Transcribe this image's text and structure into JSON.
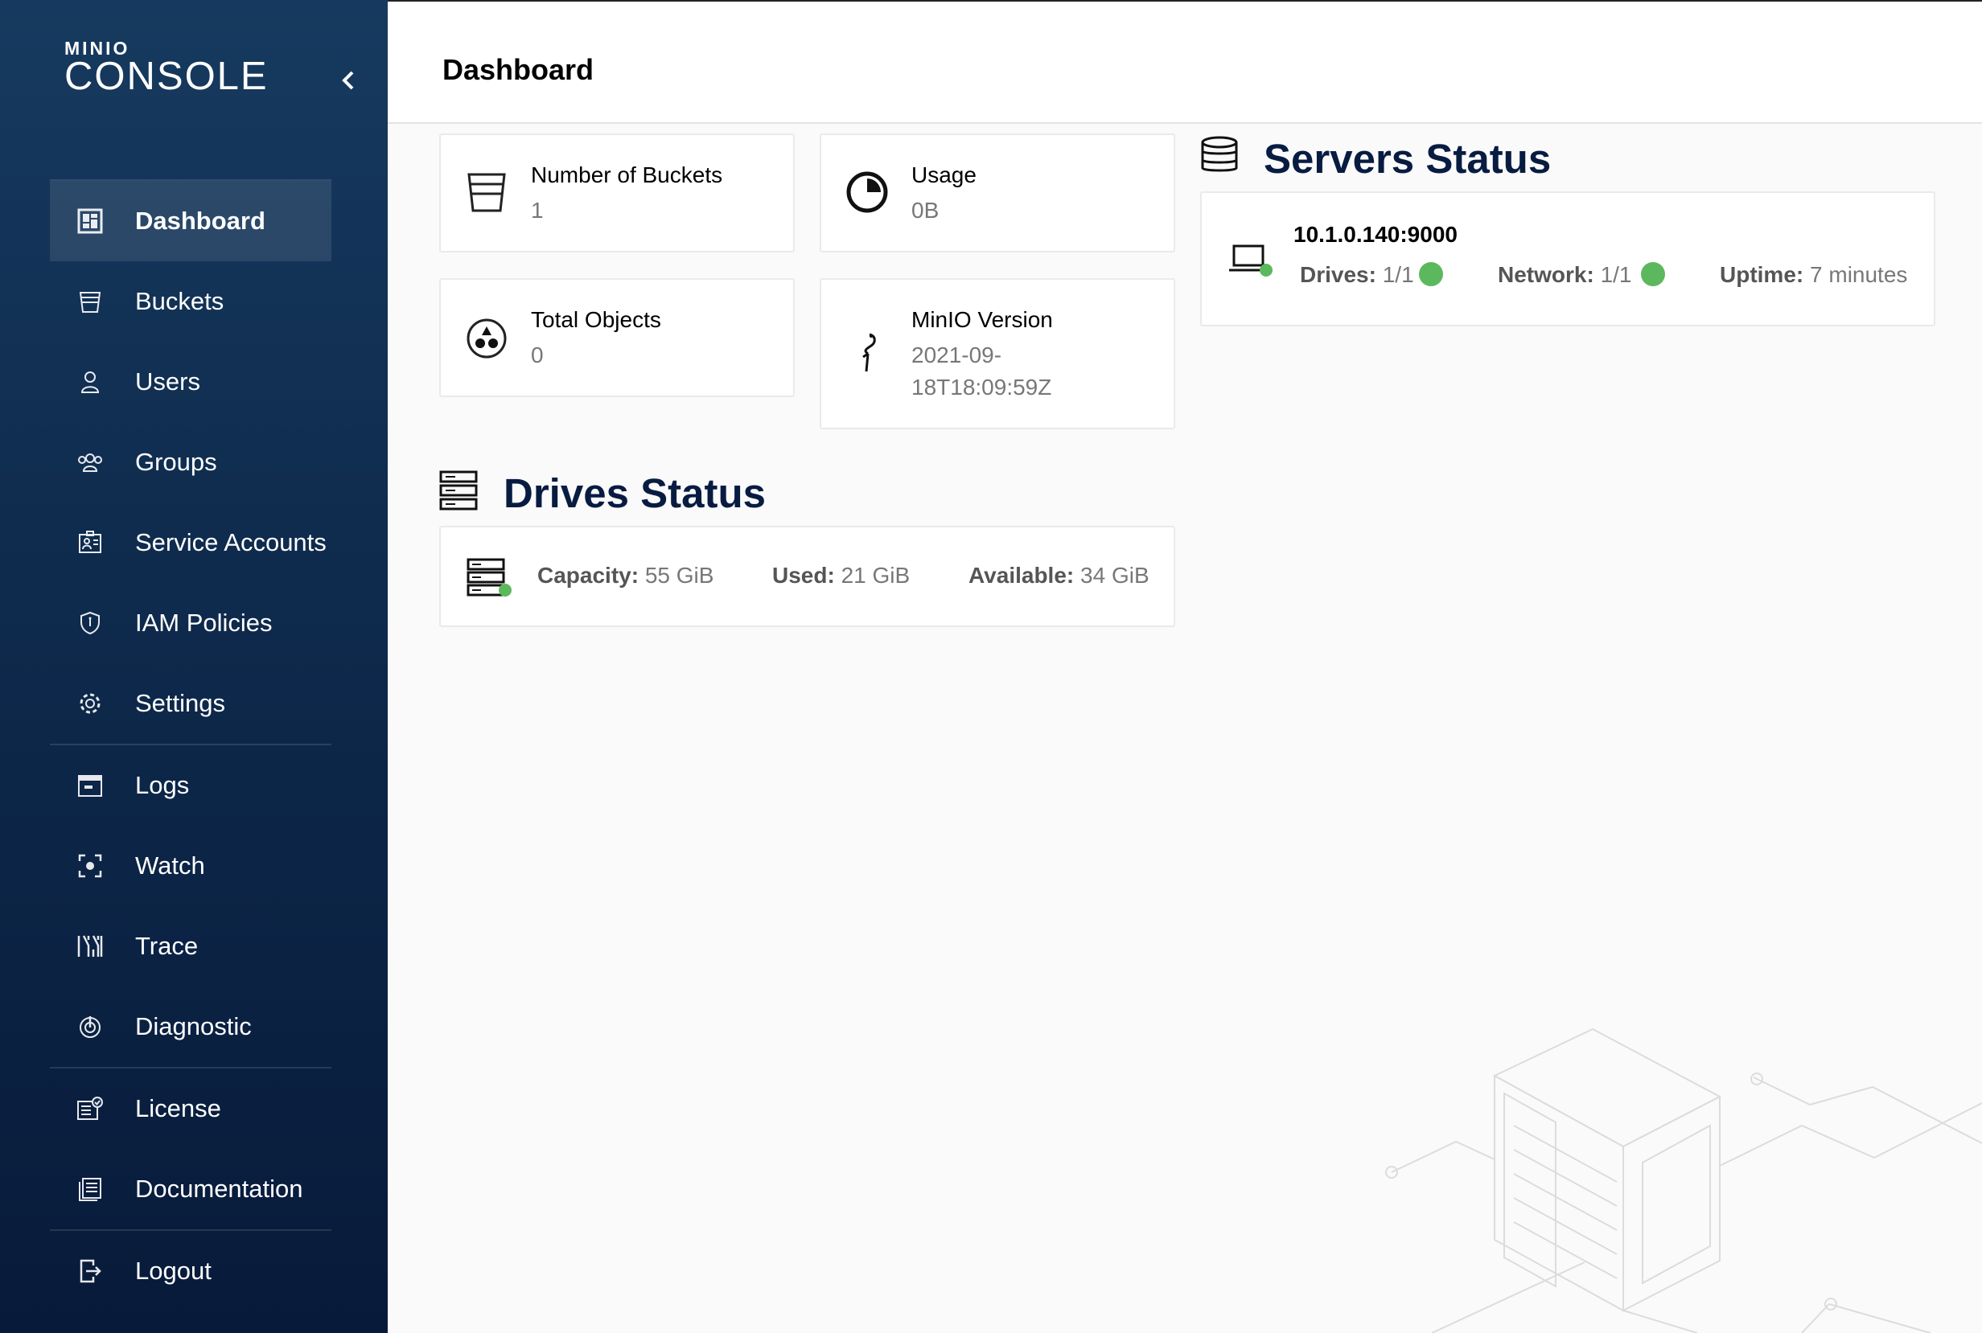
{
  "app": {
    "logo_top": "MINIO",
    "logo_bottom": "CONSOLE"
  },
  "sidebar": {
    "items": [
      {
        "label": "Dashboard",
        "icon": "dashboard-icon",
        "active": true
      },
      {
        "label": "Buckets",
        "icon": "bucket-icon"
      },
      {
        "label": "Users",
        "icon": "user-icon"
      },
      {
        "label": "Groups",
        "icon": "groups-icon"
      },
      {
        "label": "Service Accounts",
        "icon": "service-accounts-icon"
      },
      {
        "label": "IAM Policies",
        "icon": "shield-icon"
      },
      {
        "label": "Settings",
        "icon": "gear-icon"
      },
      {
        "label": "Logs",
        "icon": "logs-icon"
      },
      {
        "label": "Watch",
        "icon": "watch-icon"
      },
      {
        "label": "Trace",
        "icon": "trace-icon"
      },
      {
        "label": "Diagnostic",
        "icon": "diagnostic-icon"
      },
      {
        "label": "License",
        "icon": "license-icon"
      },
      {
        "label": "Documentation",
        "icon": "documentation-icon"
      },
      {
        "label": "Logout",
        "icon": "logout-icon"
      }
    ]
  },
  "header": {
    "title": "Dashboard"
  },
  "summary": {
    "buckets": {
      "label": "Number of Buckets",
      "value": "1"
    },
    "usage": {
      "label": "Usage",
      "value": "0B"
    },
    "objects": {
      "label": "Total Objects",
      "value": "0"
    },
    "version": {
      "label": "MinIO Version",
      "value_line1": "2021-09-",
      "value_line2": "18T18:09:59Z"
    }
  },
  "drives": {
    "title": "Drives Status",
    "capacity_label": "Capacity:",
    "capacity_value": "55 GiB",
    "used_label": "Used:",
    "used_value": "21 GiB",
    "available_label": "Available:",
    "available_value": "34 GiB"
  },
  "servers": {
    "title": "Servers Status",
    "endpoint": "10.1.0.140:9000",
    "drives_label": "Drives:",
    "drives_value": "1/1",
    "network_label": "Network:",
    "network_value": "1/1",
    "uptime_label": "Uptime:",
    "uptime_value": "7 minutes"
  },
  "colors": {
    "status_ok": "#5cb85c",
    "sidebar_bg": "#0e2a4c",
    "section_title": "#081c42"
  }
}
